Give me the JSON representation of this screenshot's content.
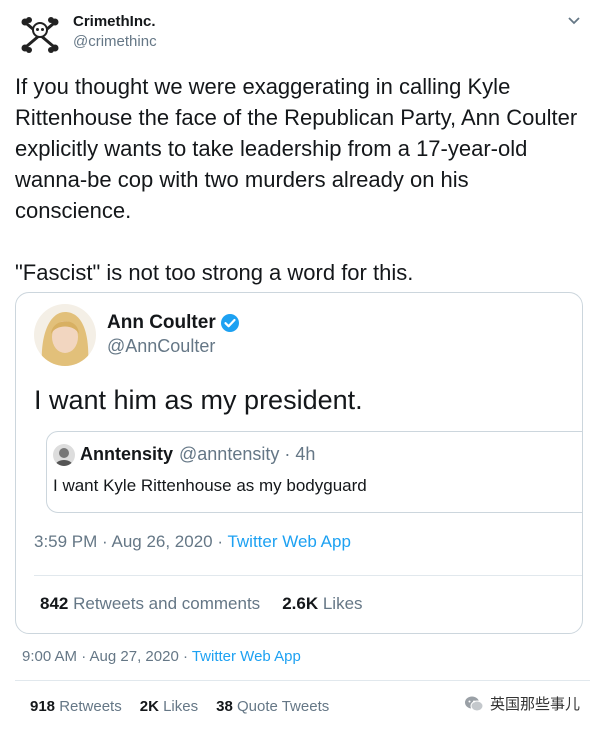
{
  "header": {
    "display_name": "CrimethInc.",
    "handle": "@crimethinc",
    "avatar_icon": "bones-cross-logo",
    "menu_icon": "chevron-down-icon"
  },
  "body": {
    "paragraph1": "If you thought we were exaggerating in calling Kyle Rittenhouse the face of the Republican Party, Ann Coulter explicitly wants to take leadership from a 17-year-old wanna-be cop with two murders already on his conscience.",
    "paragraph2": "\"Fascist\" is not too strong a word for this."
  },
  "embedded": {
    "display_name": "Ann Coulter",
    "handle": "@AnnCoulter",
    "text": "I want him as my president.",
    "quote": {
      "display_name": "Anntensity",
      "handle_time": "@anntensity · 4h",
      "text": "I want Kyle Rittenhouse as my bodyguard"
    },
    "timestamp": "3:59 PM · Aug 26, 2020 · ",
    "source": "Twitter Web App",
    "retweets_count": "842",
    "retweets_label": " Retweets and comments",
    "likes_count": "2.6K",
    "likes_label": " Likes"
  },
  "footer": {
    "timestamp": "9:00 AM · Aug 27, 2020 · ",
    "source": "Twitter Web App",
    "retweets_count": "918",
    "retweets_label": " Retweets",
    "likes_count": "2K",
    "likes_label": " Likes",
    "quotes_count": "38",
    "quotes_label": " Quote Tweets"
  },
  "watermark": {
    "text": "英国那些事儿",
    "icon": "wechat-icon"
  },
  "colors": {
    "text": "#14171a",
    "secondary": "#657786",
    "link": "#1da1f2",
    "border": "#ccd6dd",
    "verified": "#1da1f2"
  }
}
